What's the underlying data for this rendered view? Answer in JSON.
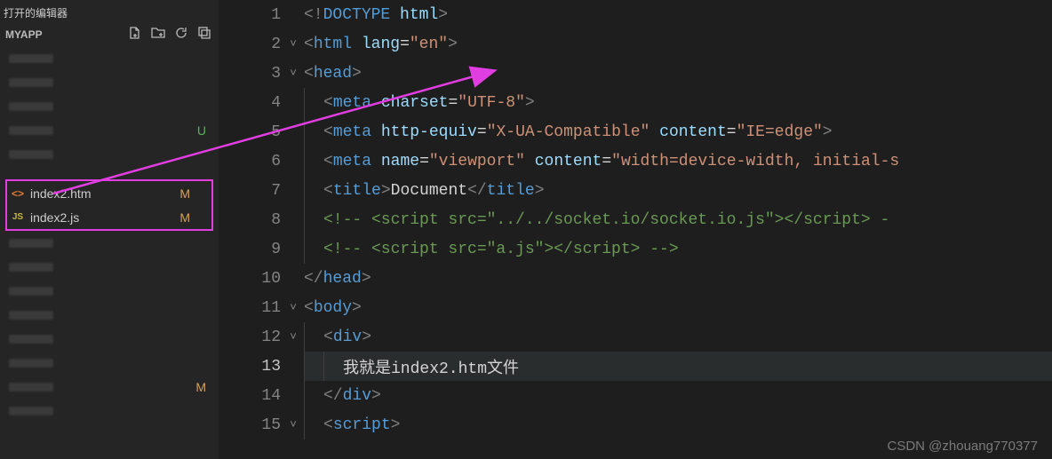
{
  "sidebar": {
    "openEditorsLabel": "打开的编辑器",
    "projectLabel": "MYAPP",
    "blurRows": [
      {
        "status": "",
        "cls": ""
      },
      {
        "status": "",
        "cls": ""
      },
      {
        "status": "",
        "cls": ""
      },
      {
        "status": "U",
        "cls": "U"
      },
      {
        "status": "",
        "cls": ""
      }
    ],
    "files": [
      {
        "icon": "<>",
        "iconCls": "ic-htm",
        "name": "index2.htm",
        "status": "M"
      },
      {
        "icon": "JS",
        "iconCls": "ic-js",
        "name": "index2.js",
        "status": "M"
      }
    ],
    "bottomRows": [
      {
        "status": "",
        "cls": ""
      },
      {
        "status": "",
        "cls": ""
      },
      {
        "status": "",
        "cls": ""
      },
      {
        "status": "",
        "cls": ""
      },
      {
        "status": "",
        "cls": ""
      },
      {
        "status": "",
        "cls": ""
      },
      {
        "status": "M",
        "cls": "M"
      },
      {
        "status": "",
        "cls": ""
      }
    ]
  },
  "editor": {
    "activeLine": 13,
    "lines": [
      {
        "n": 1,
        "fold": "",
        "indent": 0,
        "html": "<span class='br'>&lt;!</span><span class='doctype'>DOCTYPE</span> <span class='attr'>html</span><span class='br'>&gt;</span>"
      },
      {
        "n": 2,
        "fold": "˅",
        "indent": 0,
        "html": "<span class='br'>&lt;</span><span class='tag'>html</span> <span class='attr'>lang</span><span class='txt'>=</span><span class='str'>\"en\"</span><span class='br'>&gt;</span>"
      },
      {
        "n": 3,
        "fold": "˅",
        "indent": 0,
        "html": "<span class='br'>&lt;</span><span class='tag'>head</span><span class='br'>&gt;</span>"
      },
      {
        "n": 4,
        "fold": "",
        "indent": 1,
        "html": "<span class='br'>&lt;</span><span class='tag'>meta</span> <span class='attr'>charset</span><span class='txt'>=</span><span class='str'>\"UTF-8\"</span><span class='br'>&gt;</span>"
      },
      {
        "n": 5,
        "fold": "",
        "indent": 1,
        "html": "<span class='br'>&lt;</span><span class='tag'>meta</span> <span class='attr'>http-equiv</span><span class='txt'>=</span><span class='str'>\"X-UA-Compatible\"</span> <span class='attr'>content</span><span class='txt'>=</span><span class='str'>\"IE=edge\"</span><span class='br'>&gt;</span>"
      },
      {
        "n": 6,
        "fold": "",
        "indent": 1,
        "html": "<span class='br'>&lt;</span><span class='tag'>meta</span> <span class='attr'>name</span><span class='txt'>=</span><span class='str'>\"viewport\"</span> <span class='attr'>content</span><span class='txt'>=</span><span class='str'>\"width=device-width, initial-s</span>"
      },
      {
        "n": 7,
        "fold": "",
        "indent": 1,
        "html": "<span class='br'>&lt;</span><span class='tag'>title</span><span class='br'>&gt;</span><span class='txt'>Document</span><span class='br'>&lt;/</span><span class='tag'>title</span><span class='br'>&gt;</span>"
      },
      {
        "n": 8,
        "fold": "",
        "indent": 1,
        "html": "<span class='cmt'>&lt;!-- &lt;script src=\"../../socket.io/socket.io.js\"&gt;&lt;/script&gt; -</span>"
      },
      {
        "n": 9,
        "fold": "",
        "indent": 1,
        "html": "<span class='cmt'>&lt;!-- &lt;script src=\"a.js\"&gt;&lt;/script&gt; --&gt;</span>"
      },
      {
        "n": 10,
        "fold": "",
        "indent": 0,
        "html": "<span class='br'>&lt;/</span><span class='tag'>head</span><span class='br'>&gt;</span>"
      },
      {
        "n": 11,
        "fold": "˅",
        "indent": 0,
        "html": "<span class='br'>&lt;</span><span class='tag'>body</span><span class='br'>&gt;</span>"
      },
      {
        "n": 12,
        "fold": "˅",
        "indent": 1,
        "html": "<span class='br'>&lt;</span><span class='tag'>div</span><span class='br'>&gt;</span>"
      },
      {
        "n": 13,
        "fold": "",
        "indent": 2,
        "html": "<span class='txt'>我就是index2.htm文件</span>"
      },
      {
        "n": 14,
        "fold": "",
        "indent": 1,
        "html": "<span class='br'>&lt;/</span><span class='tag'>div</span><span class='br'>&gt;</span>"
      },
      {
        "n": 15,
        "fold": "˅",
        "indent": 1,
        "html": "<span class='br'>&lt;</span><span class='tag'>script</span><span class='br'>&gt;</span>"
      }
    ]
  },
  "watermark": "CSDN @zhouang770377"
}
